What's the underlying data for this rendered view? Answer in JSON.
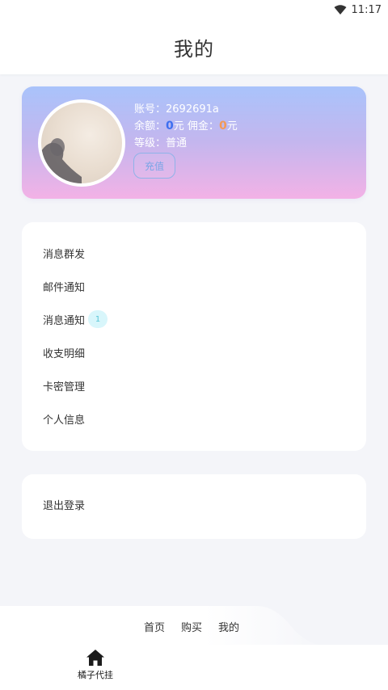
{
  "status_bar": {
    "time": "11:17",
    "wifi_icon": "wifi-icon"
  },
  "header": {
    "title": "我的"
  },
  "profile": {
    "account_label": "账号：",
    "account_value": "2692691a",
    "balance_label": "余额：",
    "balance_value": "0",
    "balance_unit": "元",
    "commission_label": "佣金：",
    "commission_value": "0",
    "commission_unit": "元",
    "level_label": "等级：",
    "level_value": "普通",
    "recharge_label": "充值"
  },
  "menu": {
    "items": [
      {
        "label": "消息群发"
      },
      {
        "label": "邮件通知"
      },
      {
        "label": "消息通知",
        "badge": "1"
      },
      {
        "label": "收支明细"
      },
      {
        "label": "卡密管理"
      },
      {
        "label": "个人信息"
      }
    ]
  },
  "logout": {
    "label": "退出登录"
  },
  "bottom_links": [
    "首页",
    "购买",
    "我的"
  ],
  "tabbar": {
    "home_label": "橘子代挂",
    "home_icon": "home-icon"
  },
  "colors": {
    "accent_blue": "#3d6ff0",
    "accent_orange": "#f39a57",
    "badge_bg": "#d8f6fb",
    "card_gradient_top": "#a9c3fb",
    "card_gradient_bottom": "#f3b2e6"
  }
}
